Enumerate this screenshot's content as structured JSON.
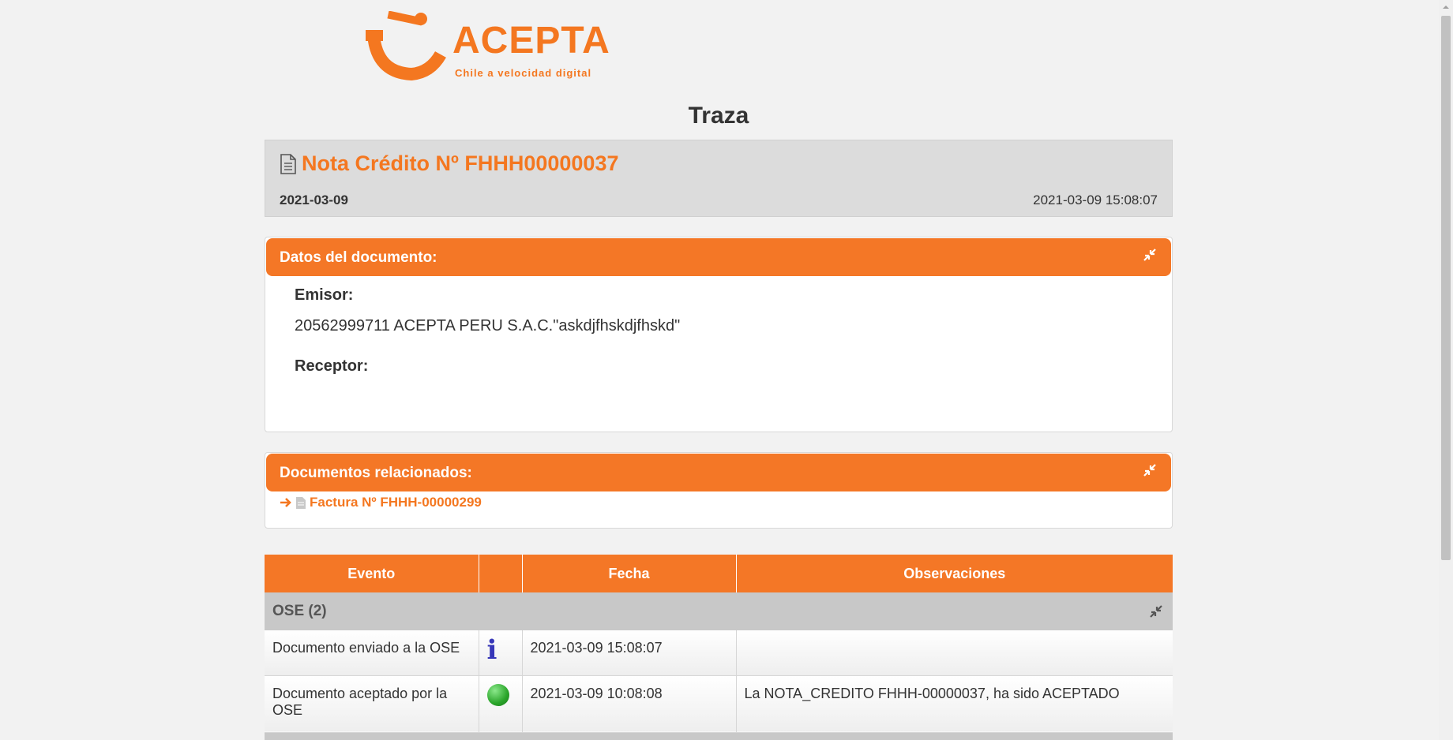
{
  "logo": {
    "brand": "ACEPTA",
    "tagline": "Chile a velocidad digital"
  },
  "page": {
    "title": "Traza"
  },
  "document": {
    "title": "Nota Crédito Nº FHHH00000037",
    "date": "2021-03-09",
    "datetime": "2021-03-09 15:08:07"
  },
  "datos": {
    "header": "Datos del documento:",
    "emisor_label": "Emisor:",
    "emisor_value": "20562999711 ACEPTA PERU S.A.C.\"askdjfhskdjfhskd\"",
    "receptor_label": "Receptor:",
    "receptor_value": ""
  },
  "relacionados": {
    "header": "Documentos relacionados:",
    "items": [
      {
        "label": "Factura Nº FHHH-00000299"
      }
    ]
  },
  "events_table": {
    "headers": [
      "Evento",
      "",
      "Fecha",
      "Observaciones"
    ],
    "group": "OSE (2)",
    "rows": [
      {
        "evento": "Documento enviado a la OSE",
        "icon": "info-icon",
        "fecha": "2021-03-09 15:08:07",
        "observaciones": ""
      },
      {
        "evento": "Documento aceptado por la OSE",
        "icon": "green-status-icon",
        "fecha": "2021-03-09 10:08:08",
        "observaciones": "La NOTA_CREDITO FHHH-00000037, ha sido ACEPTADO"
      }
    ]
  },
  "colors": {
    "accent": "#f47726",
    "link": "#f47720",
    "info": "#3737b8",
    "status_ok": "#2aa52a"
  }
}
